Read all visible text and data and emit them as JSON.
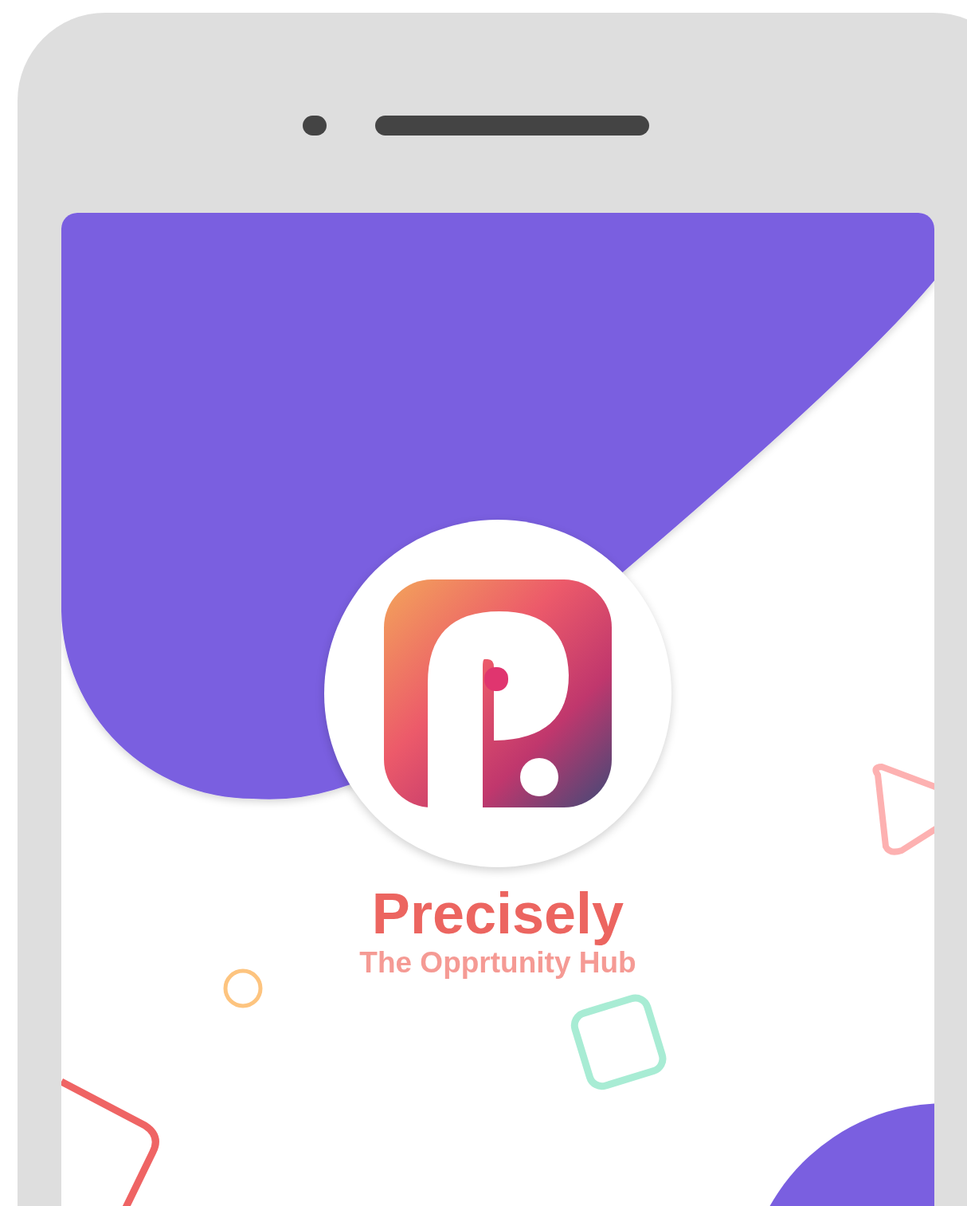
{
  "app": {
    "title": "Precisely",
    "tagline": "The Opprtunity Hub"
  }
}
